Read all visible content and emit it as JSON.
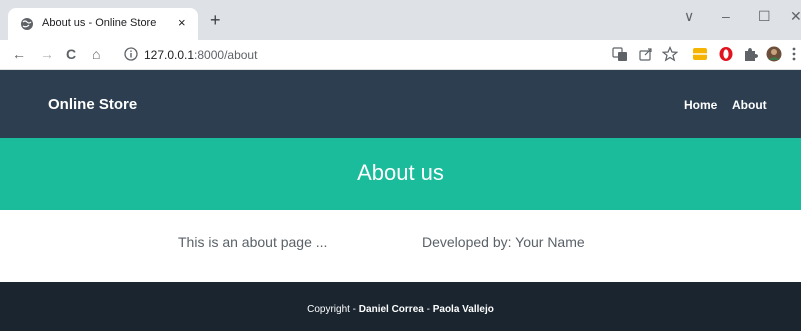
{
  "browser": {
    "tab_title": "About us - Online Store",
    "tab_close": "×",
    "new_tab": "+",
    "controls": {
      "minimize": "–",
      "maximize": "☐",
      "close": "✕",
      "chevron": "∨"
    },
    "nav": {
      "back": "←",
      "forward": "→",
      "reload": "C",
      "home": "⌂"
    },
    "url_host": "127.0.0.1",
    "url_path": ":8000/about",
    "icons": [
      "translate-icon",
      "share-icon",
      "star-icon",
      "extension-yellow-icon",
      "opera-icon",
      "puzzle-icon",
      "avatar-icon",
      "menu-icon"
    ],
    "colors": {
      "ext_yellow": "#f4b400",
      "opera_red": "#e0141e"
    }
  },
  "site": {
    "brand": "Online Store",
    "nav": {
      "home": "Home",
      "about": "About"
    },
    "hero_title": "About us",
    "content": {
      "left": "This is an about page ...",
      "right": "Developed by: Your Name"
    },
    "footer": {
      "prefix": "Copyright - ",
      "author1": "Daniel Correa",
      "sep": " - ",
      "author2": "Paola Vallejo"
    },
    "colors": {
      "navbar": "#2c3e50",
      "hero": "#1abc9c",
      "footer": "#1a252f"
    }
  }
}
